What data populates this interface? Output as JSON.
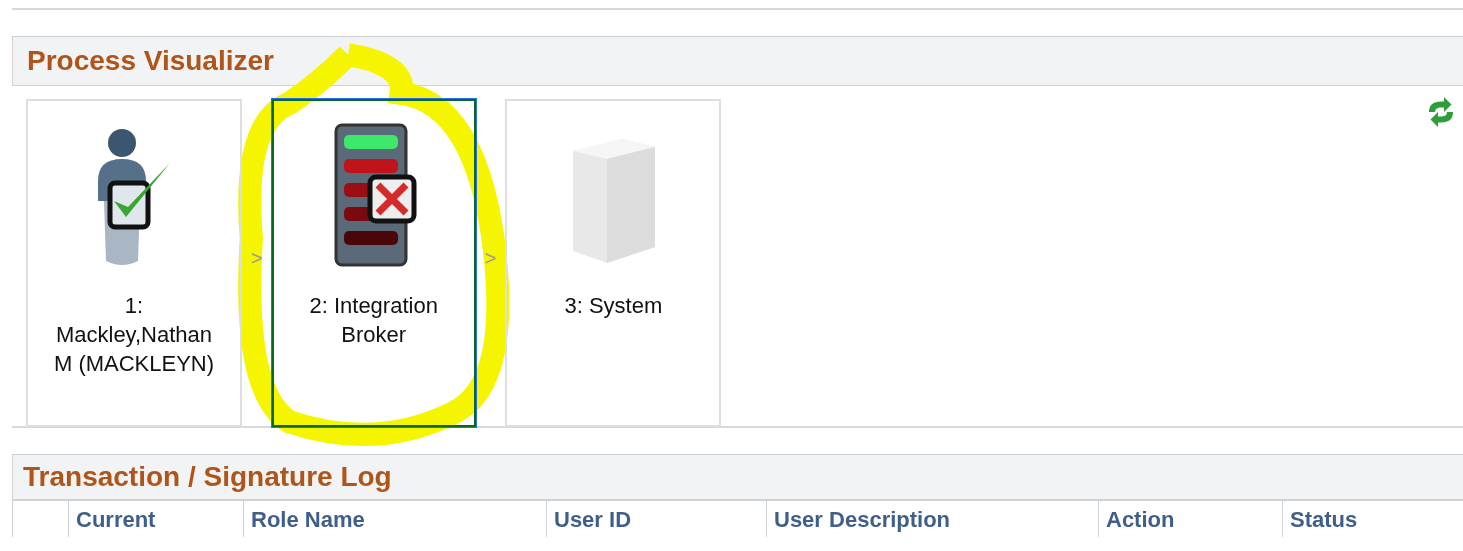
{
  "visualizer": {
    "title": "Process Visualizer",
    "steps": [
      {
        "kind": "approver",
        "label": "1: Mackley,Nathan M (MACKLEYN)",
        "selected": false,
        "arrow_after": ">"
      },
      {
        "kind": "broker-error",
        "label": "2: Integration Broker",
        "selected": true,
        "arrow_after": ">"
      },
      {
        "kind": "system",
        "label": "3: System",
        "selected": false
      }
    ]
  },
  "log": {
    "title": "Transaction / Signature Log",
    "columns": [
      "",
      "Current",
      "Role Name",
      "User ID",
      "User Description",
      "Action",
      "Status"
    ]
  }
}
